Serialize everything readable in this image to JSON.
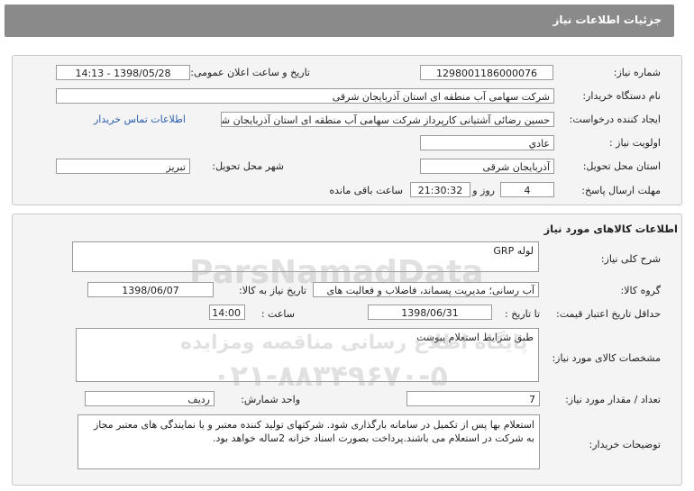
{
  "header": {
    "title": "جزئیات اطلاعات نیاز"
  },
  "info": {
    "need_number_label": "شماره نیاز:",
    "need_number": "1298001186000076",
    "announce_label": "تاریخ و ساعت اعلان عمومی:",
    "announce_value": "1398/05/28 - 14:13",
    "buyer_org_label": "نام دستگاه خریدار:",
    "buyer_org": "شرکت سهامی آب منطقه ای استان آذربایجان شرقی",
    "creator_label": "ایجاد کننده درخواست:",
    "creator": "حسین رضائی آشتیانی کارپرداز شرکت سهامی آب منطقه ای استان آذربایجان شرقی",
    "contact_link": "اطلاعات تماس خریدار",
    "priority_label": "اولویت نیاز :",
    "priority": "عادي",
    "province_label": "استان محل تحویل:",
    "province": "آذربایجان شرقی",
    "city_label": "شهر محل تحویل:",
    "city": "تبریز",
    "deadline_label": "مهلت ارسال پاسخ:",
    "deadline_days": "4",
    "days_word": "روز و",
    "deadline_time": "21:30:32",
    "remaining_label": "ساعت باقی مانده"
  },
  "goods": {
    "section_title": "اطلاعات کالاهای مورد نیاز",
    "general_desc_label": "شرح کلی نیاز:",
    "general_desc": "لوله GRP",
    "group_label": "گروه کالا:",
    "group_value": "آب رسانی؛ مدیریت پسماند، فاضلاب و فعالیت های",
    "need_date_label": "تاریخ نیاز به کالا:",
    "need_date": "1398/06/07",
    "min_price_label": "حداقل تاریخ اعتبار قیمت:",
    "until_date_label": "تا تاریخ :",
    "until_date": "1398/06/31",
    "hour_label": "ساعت :",
    "hour_value": "14:00",
    "specs_label": "مشخصات کالای مورد نیاز:",
    "specs": "طبق شرایط استعلام پیوست",
    "qty_label": "تعداد / مقدار مورد نیاز:",
    "qty": "7",
    "unit_label": "واحد شمارش:",
    "unit": "رديف",
    "buyer_notes_label": "توضیحات خریدار:",
    "buyer_notes": "استعلام بها پس از تکمیل در سامانه بارگذاری شود. شرکتهای تولید کننده معتبر و یا نمایندگی های معتبر مجاز به شرکت در استعلام می باشند.پرداخت بصورت اسناد خزانه 2ساله خواهد بود."
  },
  "watermark": {
    "brand": "ParsNamadData",
    "line1": "پایگاه اطلاع رسانی مناقصه ومزایده",
    "phone": "۰۲۱-۸۸۳۴۹۶۷۰-۵"
  }
}
